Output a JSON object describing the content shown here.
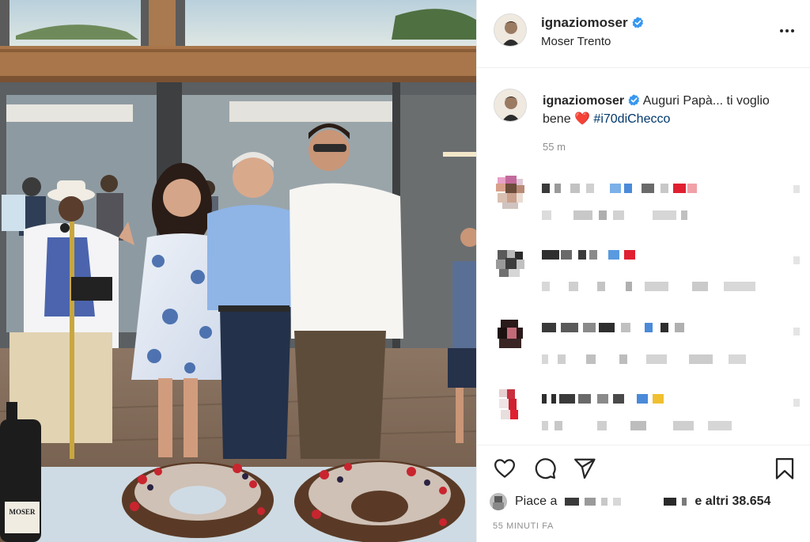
{
  "post": {
    "username": "ignaziomoser",
    "verified": true,
    "location": "Moser Trento",
    "caption_text": "Auguri Papà... ti voglio bene",
    "caption_emoji": "❤️",
    "hashtag": "#i70diChecco",
    "caption_age": "55 m",
    "likes_prefix": "Piace a",
    "likes_suffix": "e altri 38.654",
    "timestamp": "55 MINUTI FA",
    "bottle_label": "MOSER"
  },
  "icons": {
    "verified": "verified-badge-icon",
    "more": "more-options-icon",
    "like": "heart-icon",
    "comment": "comment-bubble-icon",
    "share": "paper-plane-icon",
    "save": "bookmark-icon"
  },
  "colors": {
    "verified_blue": "#3897f0",
    "text": "#262626",
    "muted": "#8e8e8e",
    "hashtag": "#00376b",
    "heart": "#e0163a"
  }
}
